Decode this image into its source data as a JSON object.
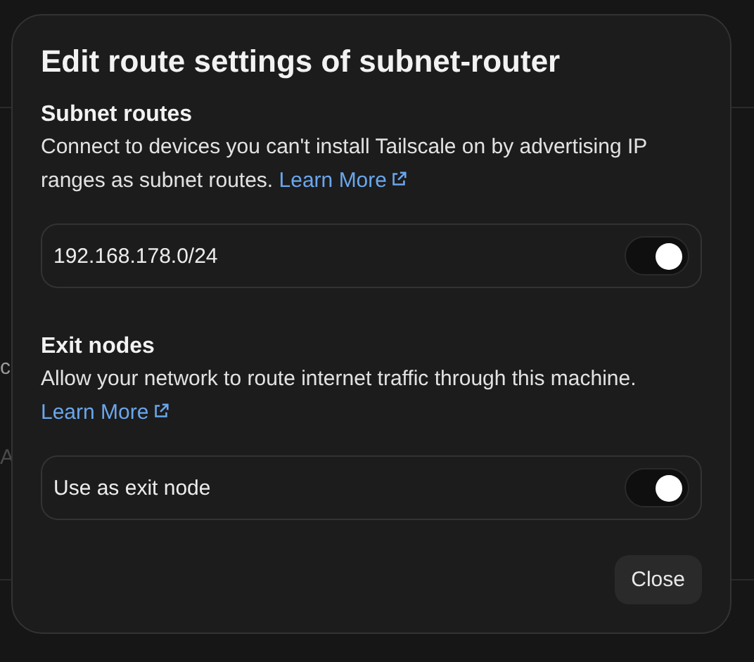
{
  "background": {
    "fragments": [
      "c",
      "A"
    ]
  },
  "dialog": {
    "title": "Edit route settings of subnet-router",
    "sections": [
      {
        "heading": "Subnet routes",
        "description": "Connect to devices you can't install Tailscale on by advertising IP ranges as subnet routes.",
        "link": "Learn More",
        "toggles": [
          {
            "label": "192.168.178.0/24",
            "on": true
          }
        ]
      },
      {
        "heading": "Exit nodes",
        "description": "Allow your network to route internet traffic through this machine.",
        "link": "Learn More",
        "toggles": [
          {
            "label": "Use as exit node",
            "on": true
          }
        ]
      }
    ],
    "buttons": [
      "Close"
    ]
  }
}
